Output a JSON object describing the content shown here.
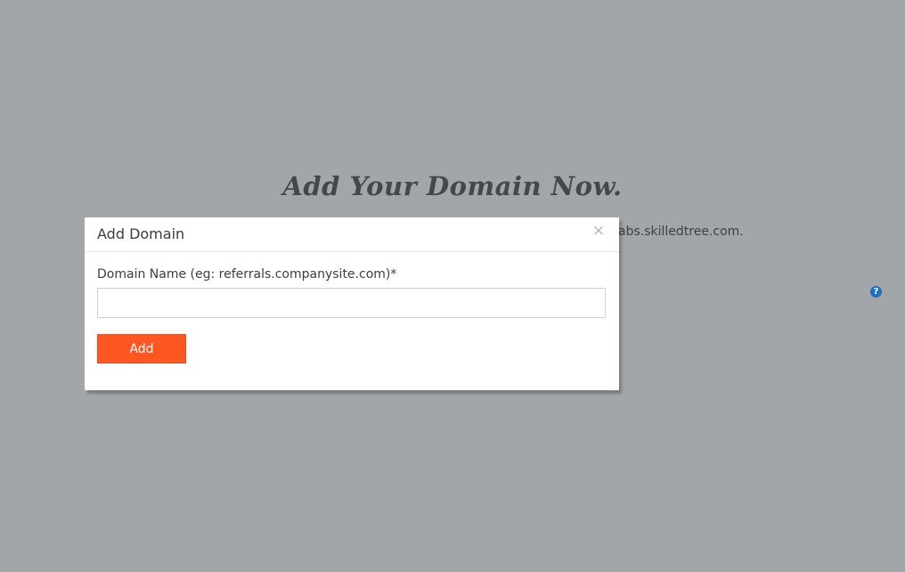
{
  "background": {
    "heading": "Add Your Domain Now.",
    "subtext_visible": "abs.skilledtree.com.",
    "help_icon_glyph": "?",
    "help_icon_name": "help-circle-icon"
  },
  "modal": {
    "title": "Add Domain",
    "close_glyph": "×",
    "field_label": "Domain Name (eg: referrals.companysite.com)*",
    "field_value": "",
    "field_placeholder": "",
    "submit_label": "Add"
  },
  "colors": {
    "overlay_background": "#a3a6a9",
    "accent_button": "#ff5722",
    "help_icon": "#1f6fc0"
  }
}
